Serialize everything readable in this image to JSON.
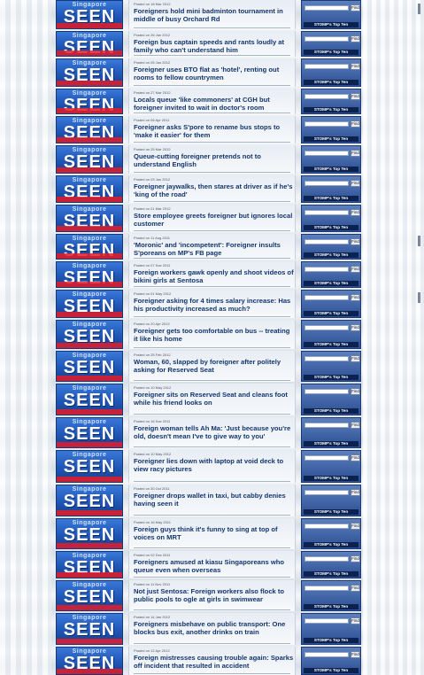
{
  "logo": {
    "top_text": "Singapore",
    "main_text": "SEEN"
  },
  "sidebar": {
    "find_label": "Find",
    "stomp_label": "STOMP's Top Ten"
  },
  "stories": [
    {
      "meta": "Posted on 18 Mar 2012",
      "title": "Foreigners hold mini badminton tournament in middle of busy Orchard Rd"
    },
    {
      "meta": "Posted on 26 Jan 2012",
      "title": "Foreign bus captain speeds and rants loudly at family who can't understand him"
    },
    {
      "meta": "Posted on 05 Jan 2012",
      "title": "Foreigner uses BTO flat as 'hotel', renting out rooms to fellow countrymen"
    },
    {
      "meta": "Posted on 27 Mar 2012",
      "title": "Locals queue 'like commoners' at CGH but foreigner invited to wait in doctor's room"
    },
    {
      "meta": "Posted on 06 Apr 2011",
      "title": "Foreigner asks S'pore to rename bus stops to 'make it easier' for them"
    },
    {
      "meta": "Posted on 25 Mar 2012",
      "title": "Queue-cutting foreigner pretends not to understand English"
    },
    {
      "meta": "Posted on 03 Jan 2012",
      "title": "Foreigner jaywalks, then stares at driver as if he's 'king of the road'"
    },
    {
      "meta": "Posted on 21 Mar 2012",
      "title": "Store employee greets foreigner but ignores local customer"
    },
    {
      "meta": "Posted on 11 Aug 2011",
      "title": "'Moronic' and 'incompetent': Foreigner insults S'poreans on MP's FB page"
    },
    {
      "meta": "Posted on 07 Nov 2011",
      "title": "Foreign workers gawk openly and shoot videos of bikini girls at Sentosa"
    },
    {
      "meta": "Posted on 01 May 2012",
      "title": "Foreigner asking for 4 times salary increase: Has his productivity increased as much?"
    },
    {
      "meta": "Posted on 20 Apr 2012",
      "title": "Foreigner gets too comfortable on bus -- treating it like his home"
    },
    {
      "meta": "Posted on 25 Feb 2012",
      "title": "Woman, 60, slapped by foreigner after politely asking for Reserved Seat"
    },
    {
      "meta": "Posted on 10 May 2012",
      "title": "Foreigner sits on Reserved Seat and cleans foot while his friend looks on"
    },
    {
      "meta": "Posted on 16 Nov 2011",
      "title": "Foreign woman tells Ah Ma: 'Just because you're old, doesn't mean I've to give way to you'"
    },
    {
      "meta": "Posted on 10 May 2012",
      "title": "Foreigner lies down with laptop at void deck to view racy pictures"
    },
    {
      "meta": "Posted on 30 Oct 2011",
      "title": "Foreigner drops wallet in taxi, but cabby denies having seen it"
    },
    {
      "meta": "Posted on 16 May 2011",
      "title": "Foreign guys think it's funny to sing at top of voices on MRT"
    },
    {
      "meta": "Posted on 02 Dec 2011",
      "title": "Foreigners amused at kiasu Singaporeans who queue even when overseas"
    },
    {
      "meta": "Posted on 11 Nov 2011",
      "title": "Not just Sentosa: Foreign workers also flock to public pools to ogle at girls in swimwear"
    },
    {
      "meta": "Posted on 14 Jan 2012",
      "title": "Foreigners misbehave on public transport: One blocks bus exit, another drinks on train"
    },
    {
      "meta": "Posted on 12 Apr 2012",
      "title": "Foreign mistresses causing trouble again: Sparks off incident that resulted in accident"
    }
  ]
}
